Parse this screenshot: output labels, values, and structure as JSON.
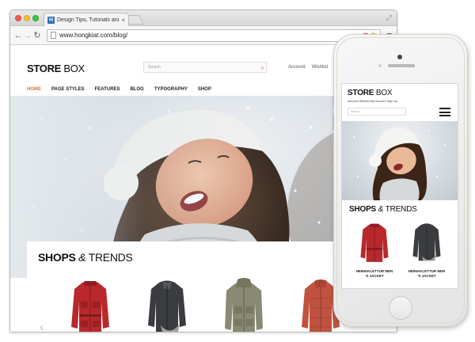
{
  "browser": {
    "tab_title": "Design Tips, Tutorials and",
    "favicon_letter": "H",
    "url": "www.hongkiat.com/blog/"
  },
  "site": {
    "logo_bold": "STORE",
    "logo_light": " BOX",
    "search_placeholder": "Search",
    "account_links": [
      "Account",
      "Wishlist"
    ],
    "nav": [
      {
        "label": "HOME",
        "active": true
      },
      {
        "label": "PAGE STYLES",
        "active": false
      },
      {
        "label": "FEATURES",
        "active": false
      },
      {
        "label": "BLOG",
        "active": false
      },
      {
        "label": "TYPOGRAPHY",
        "active": false
      },
      {
        "label": "SHOP",
        "active": false
      }
    ],
    "accent_color": "#e8703a",
    "section_title_bold": "SHOPS",
    "section_title_amp": " & ",
    "section_title_rest": "TRENDS",
    "products": [
      {
        "color": "#b8282c",
        "type": "red-field-jacket"
      },
      {
        "color": "#3a3c3f",
        "type": "dark-gray-jacket"
      },
      {
        "color": "#8a8a74",
        "type": "olive-parka"
      },
      {
        "color": "#c0533f",
        "type": "red-down-jacket"
      }
    ]
  },
  "phone": {
    "logo_bold": "STORE",
    "logo_light": " BOX",
    "account_links": "Account Wishlist My Account Sign Up",
    "search_placeholder": "Search",
    "section_title_bold": "SHOPS",
    "section_title_amp": " & ",
    "section_title_rest": "TRENDS",
    "product_captions": [
      "HEIMAKLETTUR MEN 'S JACKET",
      "HEIMAKLETTUR MEN 'S JACKET"
    ]
  }
}
